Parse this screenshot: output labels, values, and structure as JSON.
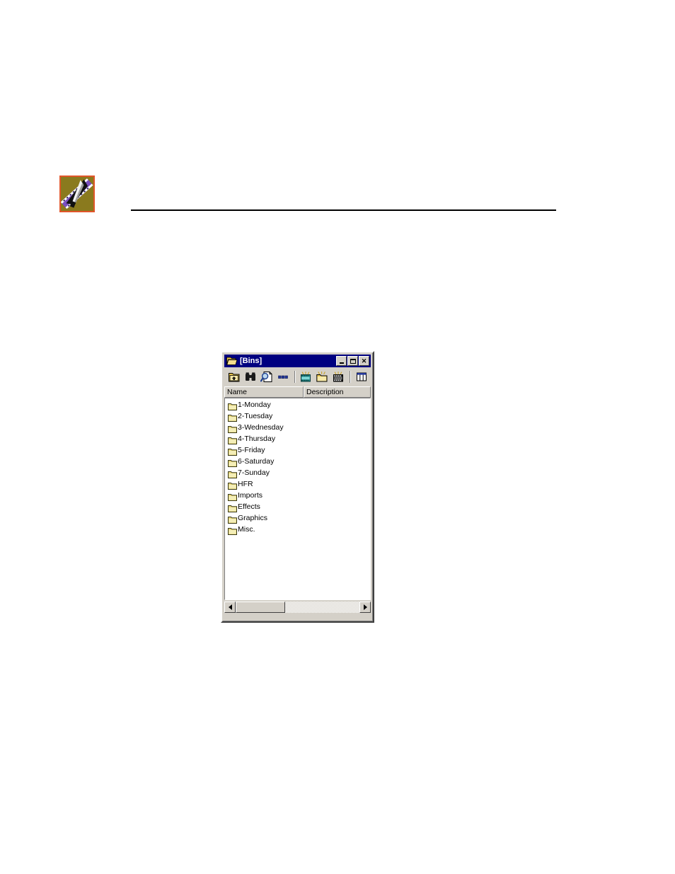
{
  "page": {
    "background_color": "#ffffff",
    "header": {
      "logo_icon": "avid-film-splicer-icon",
      "logo_bg_color": "#8a7a1e",
      "logo_border_color": "#e1562a",
      "rule_color": "#000000"
    }
  },
  "window": {
    "titlebar": {
      "icon": "open-folder-icon",
      "title": "[Bins]",
      "bg_color": "#000080",
      "text_color": "#ffffff",
      "buttons": [
        {
          "name": "minimize-button",
          "label": "_"
        },
        {
          "name": "maximize-button",
          "label": "□"
        },
        {
          "name": "close-button",
          "label": "×"
        }
      ]
    },
    "toolbar": {
      "bg_color": "#d4d0c8",
      "items": [
        {
          "name": "go-up-folder-button",
          "icon": "up-folder-icon",
          "label": "Up One Level"
        },
        {
          "name": "find-button",
          "icon": "binoculars-icon",
          "label": "Find"
        },
        {
          "name": "preview-button",
          "icon": "magnify-document-icon",
          "label": "Preview"
        },
        {
          "name": "properties-button",
          "icon": "properties-dots-icon",
          "label": "Properties"
        },
        {
          "name": "separator-1",
          "icon": "separator",
          "label": ""
        },
        {
          "name": "new-sequence-button",
          "icon": "new-sequence-film-icon",
          "label": "New Sequence"
        },
        {
          "name": "new-bin-button",
          "icon": "new-bin-folder-icon",
          "label": "New Bin"
        },
        {
          "name": "new-clip-button",
          "icon": "new-clip-film-icon",
          "label": "New Clip"
        },
        {
          "name": "separator-2",
          "icon": "separator",
          "label": ""
        },
        {
          "name": "choose-columns-button",
          "icon": "columns-icon",
          "label": "Choose Columns"
        }
      ]
    },
    "list": {
      "columns": [
        {
          "name": "column-header-name",
          "label": "Name"
        },
        {
          "name": "column-header-description",
          "label": "Description"
        }
      ],
      "rows": [
        {
          "icon": "folder-icon",
          "name": "1-Monday",
          "description": ""
        },
        {
          "icon": "folder-icon",
          "name": "2-Tuesday",
          "description": ""
        },
        {
          "icon": "folder-icon",
          "name": "3-Wednesday",
          "description": ""
        },
        {
          "icon": "folder-icon",
          "name": "4-Thursday",
          "description": ""
        },
        {
          "icon": "folder-icon",
          "name": "5-Friday",
          "description": ""
        },
        {
          "icon": "folder-icon",
          "name": "6-Saturday",
          "description": ""
        },
        {
          "icon": "folder-icon",
          "name": "7-Sunday",
          "description": ""
        },
        {
          "icon": "folder-icon",
          "name": "HFR",
          "description": ""
        },
        {
          "icon": "folder-icon",
          "name": "Imports",
          "description": ""
        },
        {
          "icon": "folder-icon",
          "name": "Effects",
          "description": ""
        },
        {
          "icon": "folder-icon",
          "name": "Graphics",
          "description": ""
        },
        {
          "icon": "folder-icon",
          "name": "Misc.",
          "description": ""
        }
      ]
    },
    "scrollbar": {
      "left_arrow": "scroll-left-arrow-icon",
      "right_arrow": "scroll-right-arrow-icon",
      "thumb_position_percent": 0,
      "thumb_width_percent": 40
    }
  }
}
